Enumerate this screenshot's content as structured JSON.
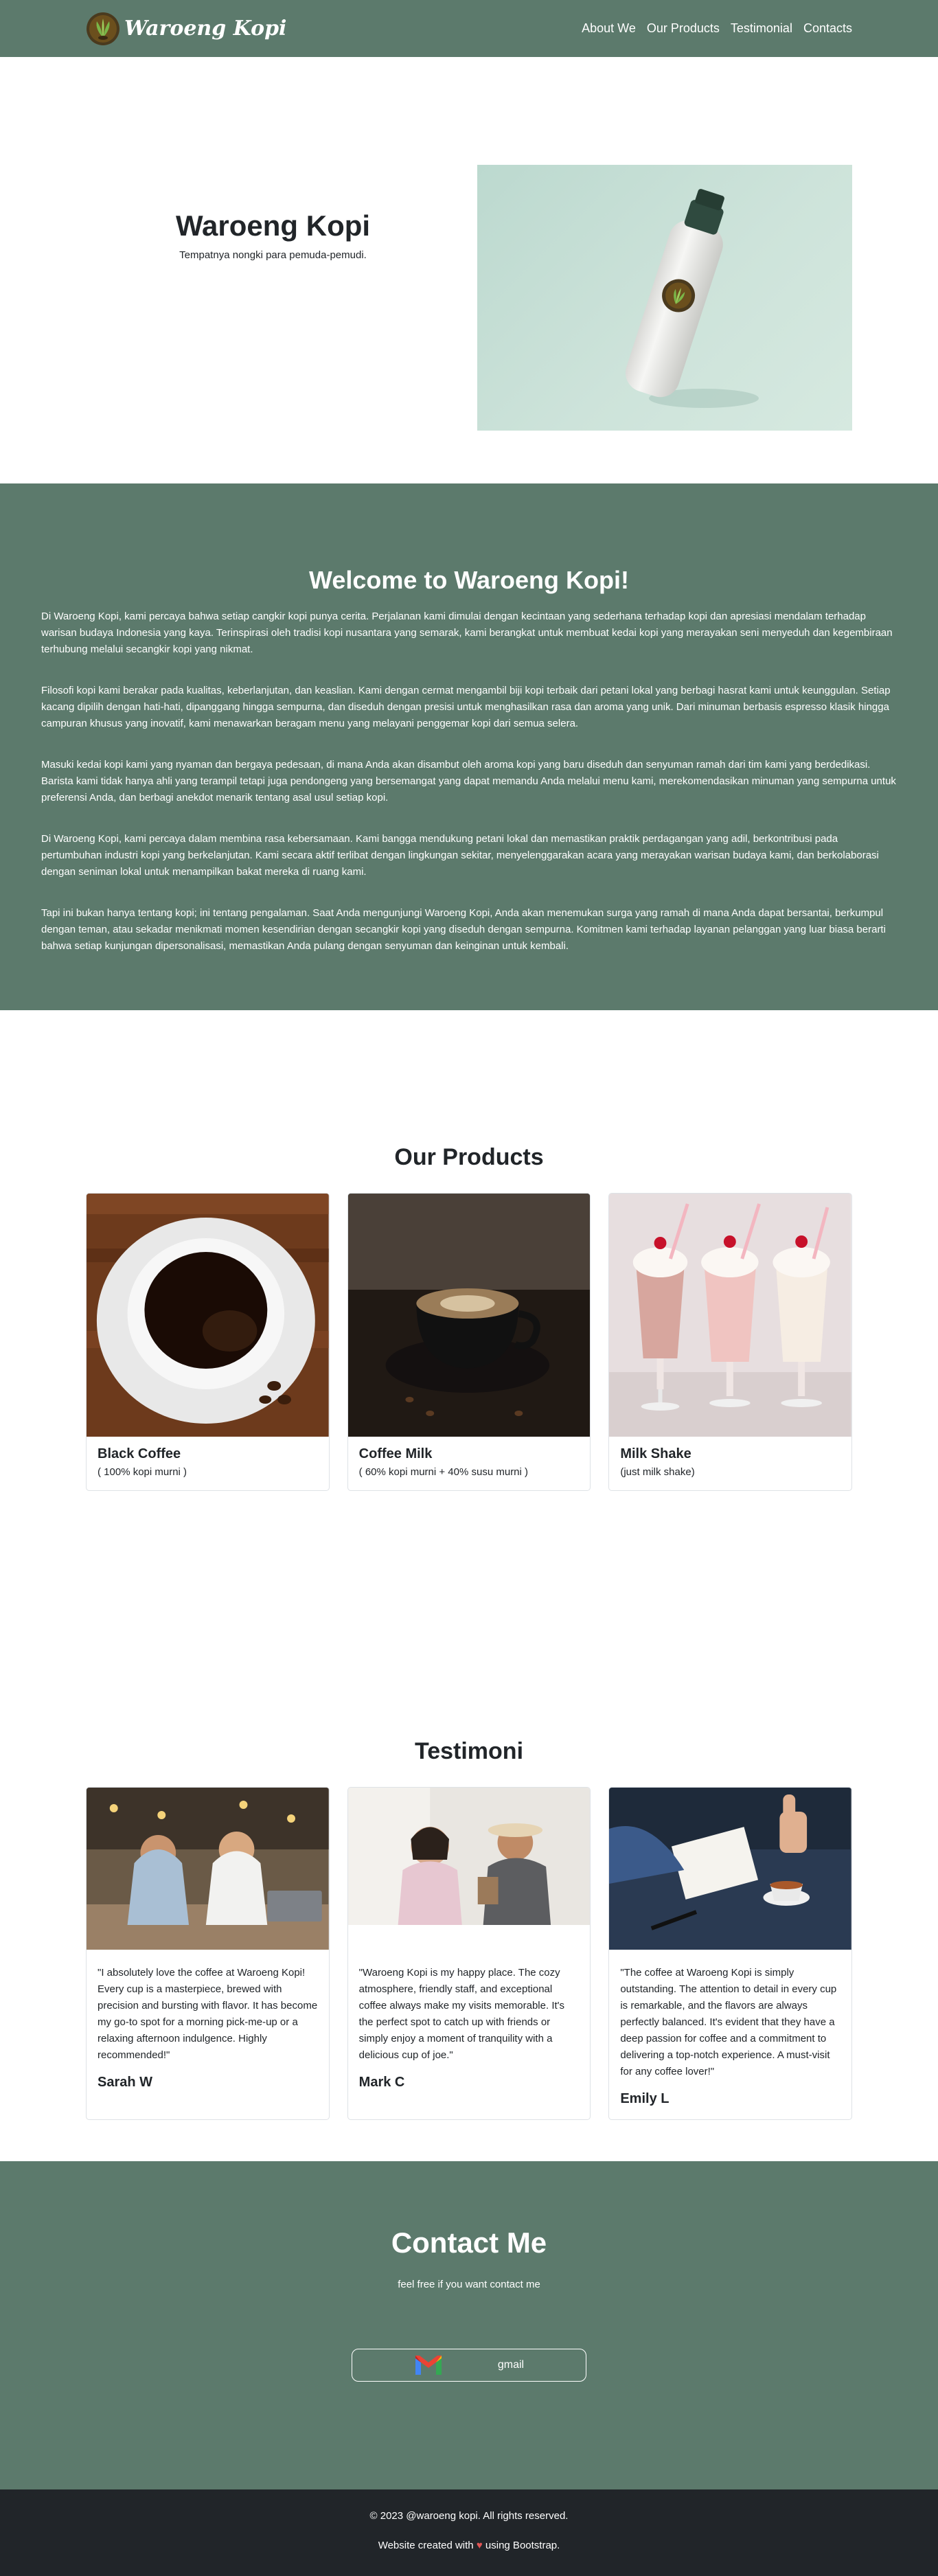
{
  "navbar": {
    "brand": "Waroeng Kopi",
    "links": [
      "About We",
      "Our Products",
      "Testimonial",
      "Contacts"
    ]
  },
  "hero": {
    "title": "Waroeng Kopi",
    "subtitle": "Tempatnya nongki para pemuda-pemudi."
  },
  "welcome": {
    "title": "Welcome to Waroeng Kopi!",
    "paragraphs": [
      "Di Waroeng Kopi, kami percaya bahwa setiap cangkir kopi punya cerita. Perjalanan kami dimulai dengan kecintaan yang sederhana terhadap kopi dan apresiasi mendalam terhadap warisan budaya Indonesia yang kaya. Terinspirasi oleh tradisi kopi nusantara yang semarak, kami berangkat untuk membuat kedai kopi yang merayakan seni menyeduh dan kegembiraan terhubung melalui secangkir kopi yang nikmat.",
      "Filosofi kopi kami berakar pada kualitas, keberlanjutan, dan keaslian. Kami dengan cermat mengambil biji kopi terbaik dari petani lokal yang berbagi hasrat kami untuk keunggulan. Setiap kacang dipilih dengan hati-hati, dipanggang hingga sempurna, dan diseduh dengan presisi untuk menghasilkan rasa dan aroma yang unik. Dari minuman berbasis espresso klasik hingga campuran khusus yang inovatif, kami menawarkan beragam menu yang melayani penggemar kopi dari semua selera.",
      "Masuki kedai kopi kami yang nyaman dan bergaya pedesaan, di mana Anda akan disambut oleh aroma kopi yang baru diseduh dan senyuman ramah dari tim kami yang berdedikasi. Barista kami tidak hanya ahli yang terampil tetapi juga pendongeng yang bersemangat yang dapat memandu Anda melalui menu kami, merekomendasikan minuman yang sempurna untuk preferensi Anda, dan berbagi anekdot menarik tentang asal usul setiap kopi.",
      "Di Waroeng Kopi, kami percaya dalam membina rasa kebersamaan. Kami bangga mendukung petani lokal dan memastikan praktik perdagangan yang adil, berkontribusi pada pertumbuhan industri kopi yang berkelanjutan. Kami secara aktif terlibat dengan lingkungan sekitar, menyelenggarakan acara yang merayakan warisan budaya kami, dan berkolaborasi dengan seniman lokal untuk menampilkan bakat mereka di ruang kami.",
      "Tapi ini bukan hanya tentang kopi; ini tentang pengalaman. Saat Anda mengunjungi Waroeng Kopi, Anda akan menemukan surga yang ramah di mana Anda dapat bersantai, berkumpul dengan teman, atau sekadar menikmati momen kesendirian dengan secangkir kopi yang diseduh dengan sempurna. Komitmen kami terhadap layanan pelanggan yang luar biasa berarti bahwa setiap kunjungan dipersonalisasi, memastikan Anda pulang dengan senyuman dan keinginan untuk kembali."
    ]
  },
  "products": {
    "title": "Our Products",
    "items": [
      {
        "name": "Black Coffee",
        "desc": "( 100% kopi murni )"
      },
      {
        "name": "Coffee Milk",
        "desc": "( 60% kopi murni + 40% susu murni )"
      },
      {
        "name": "Milk Shake",
        "desc": "(just milk shake)"
      }
    ]
  },
  "testimoni": {
    "title": "Testimoni",
    "items": [
      {
        "text": "\"I absolutely love the coffee at Waroeng Kopi! Every cup is a masterpiece, brewed with precision and bursting with flavor. It has become my go-to spot for a morning pick-me-up or a relaxing afternoon indulgence. Highly recommended!\"",
        "name": "Sarah W"
      },
      {
        "text": "\"Waroeng Kopi is my happy place. The cozy atmosphere, friendly staff, and exceptional coffee always make my visits memorable. It's the perfect spot to catch up with friends or simply enjoy a moment of tranquility with a delicious cup of joe.\"",
        "name": "Mark C"
      },
      {
        "text": "\"The coffee at Waroeng Kopi is simply outstanding. The attention to detail in every cup is remarkable, and the flavors are always perfectly balanced. It's evident that they have a deep passion for coffee and a commitment to delivering a top-notch experience. A must-visit for any coffee lover!\"",
        "name": "Emily L"
      }
    ]
  },
  "contact": {
    "title": "Contact Me",
    "subtitle": "feel free if you want contact me",
    "gmail_label": "gmail"
  },
  "footer": {
    "copyright": "© 2023 @waroeng kopi. All rights reserved.",
    "created_prefix": "Website created with",
    "created_suffix": "using Bootstrap."
  },
  "colors": {
    "primary_green": "#5c7a6c",
    "footer_dark": "#212529"
  }
}
